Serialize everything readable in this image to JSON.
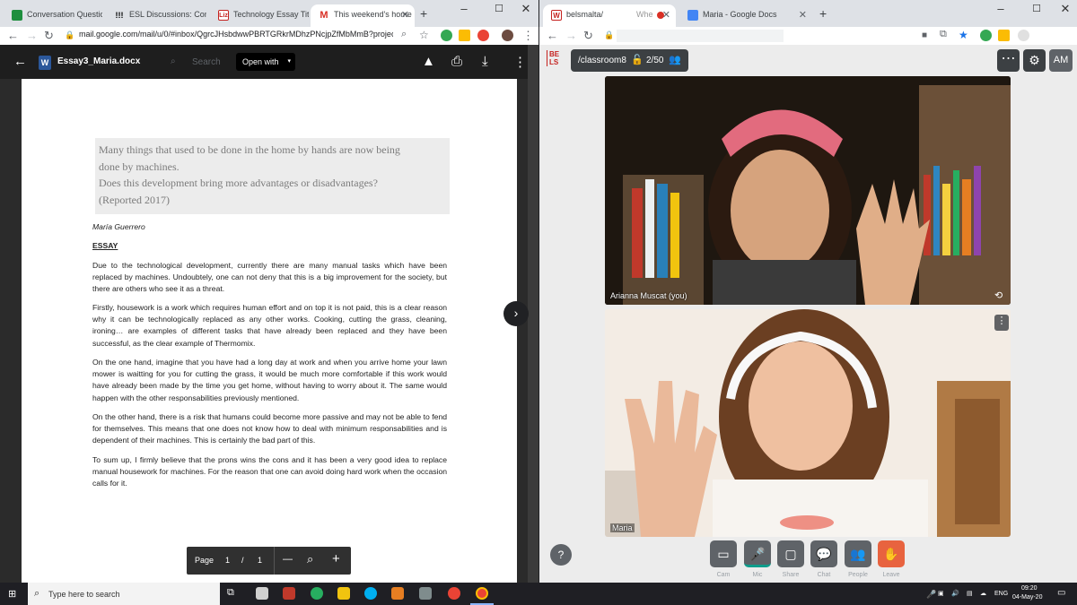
{
  "left_browser": {
    "tabs": [
      {
        "title": "Conversation Questio",
        "favicon": "green-square-icon"
      },
      {
        "title": "ESL Discussions: Conv",
        "favicon": "exclamation-icon"
      },
      {
        "title": "Technology Essay Title",
        "favicon": "liz-icon"
      },
      {
        "title": "This weekend's home",
        "favicon": "gmail-icon"
      }
    ],
    "url": "mail.google.com/mail/u/0/#inbox/QgrcJHsbdwwPBRTGRkrMDhzPNcjpZfMbMmB?projec..."
  },
  "viewer": {
    "doc_badge": "W",
    "filename": "Essay3_Maria.docx",
    "search_ghost": "Search",
    "open_with": "Open with"
  },
  "document": {
    "prompt": [
      "Many things that used to be done in the home by hands are now being",
      "done by machines.",
      "Does this development bring more advantages or disadvantages?",
      "(Reported 2017)"
    ],
    "author": "María Guerrero",
    "title": "ESSAY",
    "paragraphs": [
      "Due to the technological development, currently there are many manual tasks which have been replaced by machines. Undoubtely, one can not deny that this is a big improvement for the society, but there are others who see it as a threat.",
      "Firstly, housework is a work which requires human effort and on top it is not paid, this is a clear reason why it can be technologically replaced as any other works. Cooking, cutting the grass, cleaning, ironing… are examples of different tasks that have already been replaced and they have been successful, as the clear example of Thermomix.",
      "On the one hand, imagine that you have had a long day at work and when you arrive home your lawn mower is waitting for you for cutting the grass, it would be much more comfortable if this work would have already been made by the time you get home, without having to worry about it. The same would happen with the other responsabilities previously mentioned.",
      "On the other hand, there is a risk that humans could become more passive and may not be able to fend for themselves. This means that one does not know how to deal with minimum responsabilities and is dependent of their machines. This is certainly the bad part of this.",
      "To sum up, I firmly believe that the prons wins the cons and it has been a very good idea to replace manual housework for machines. For the reason that one can avoid doing hard work when the occasion calls for it."
    ]
  },
  "pager": {
    "label": "Page",
    "current": "1",
    "sep": "/",
    "total": "1",
    "zoom_out": "—",
    "zoom_in": "+"
  },
  "right_browser": {
    "tabs": [
      {
        "title": "belsmalta/",
        "extra": "Whe",
        "favicon": "bels-icon"
      },
      {
        "title": "Maria - Google Docs",
        "favicon": "docs-icon"
      }
    ]
  },
  "meet": {
    "logo": "BE LS",
    "room": "/classroom8",
    "participants": "2/50",
    "avatar": "AM",
    "videos": [
      {
        "name": "Arianna Muscat (you)"
      },
      {
        "name": "Maria"
      }
    ],
    "help": "?",
    "controls": [
      {
        "label": "Cam",
        "icon": "camera-icon"
      },
      {
        "label": "Mic",
        "icon": "mic-icon"
      },
      {
        "label": "Share",
        "icon": "screen-share-icon"
      },
      {
        "label": "Chat",
        "icon": "chat-icon"
      },
      {
        "label": "People",
        "icon": "people-icon"
      },
      {
        "label": "Leave",
        "icon": "wave-icon"
      }
    ]
  },
  "taskbar": {
    "search_placeholder": "Type here to search",
    "language": "ENG",
    "time": "09:20",
    "date": "04-May-20"
  },
  "colors": {
    "leave": "#e8633f",
    "mic_active": "#0f9d8c",
    "gmail_red": "#d93025",
    "doc_blue": "#2b579a"
  }
}
